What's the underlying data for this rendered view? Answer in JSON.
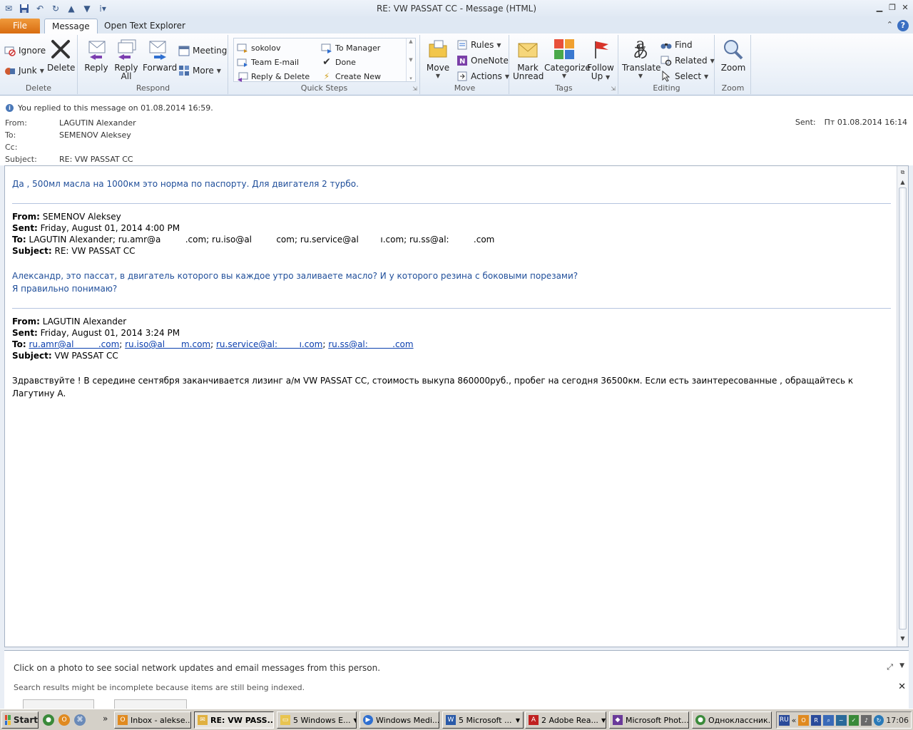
{
  "window": {
    "title": "RE: VW PASSAT CC  -  Message (HTML)"
  },
  "ribbon_tabs": {
    "file": "File",
    "message": "Message",
    "open_text_explorer": "Open Text Explorer"
  },
  "ribbon": {
    "delete_group": {
      "ignore": "Ignore",
      "junk": "Junk",
      "delete": "Delete",
      "label": "Delete"
    },
    "respond_group": {
      "reply": "Reply",
      "reply_all_1": "Reply",
      "reply_all_2": "All",
      "forward": "Forward",
      "meeting": "Meeting",
      "more": "More",
      "label": "Respond"
    },
    "quick_steps": {
      "items": [
        "sokolov",
        "Team E-mail",
        "Reply & Delete",
        "To Manager",
        "Done",
        "Create New"
      ],
      "label": "Quick Steps"
    },
    "move_group": {
      "move": "Move",
      "rules": "Rules",
      "onenote": "OneNote",
      "actions": "Actions",
      "label": "Move"
    },
    "tags_group": {
      "mark_unread_1": "Mark",
      "mark_unread_2": "Unread",
      "categorize": "Categorize",
      "follow_up_1": "Follow",
      "follow_up_2": "Up",
      "label": "Tags"
    },
    "editing_group": {
      "translate": "Translate",
      "find": "Find",
      "related": "Related",
      "select": "Select",
      "label": "Editing"
    },
    "zoom_group": {
      "zoom": "Zoom",
      "label": "Zoom"
    }
  },
  "header": {
    "info": "You replied to this message on 01.08.2014 16:59.",
    "from_label": "From:",
    "from": "LAGUTIN Alexander",
    "to_label": "To:",
    "to": "SEMENOV Aleksey",
    "cc_label": "Cc:",
    "subject_label": "Subject:",
    "subject": "RE: VW PASSAT CC",
    "sent_label": "Sent:",
    "sent": "Пт 01.08.2014 16:14"
  },
  "body": {
    "reply_text": "Да , 500мл масла на 1000км это норма по паспорту. Для двигателя 2 турбо.",
    "quote1": {
      "from_label": "From:",
      "from": " SEMENOV Aleksey",
      "sent_label": "Sent:",
      "sent": " Friday, August 01, 2014 4:00 PM",
      "to_label": "To:",
      "to": " LAGUTIN Alexander; ru.amr@a         .com; ru.iso@al         com; ru.service@al        ı.com; ru.ss@al:         .com",
      "subject_label": "Subject:",
      "subject": " RE: VW PASSAT CC",
      "line1": "Александр, это пассат, в двигатель которого вы каждое утро заливаете масло? И у которого резина с боковыми порезами?",
      "line2": "Я правильно понимаю?"
    },
    "quote2": {
      "from_label": "From:",
      "from": " LAGUTIN Alexander",
      "sent_label": "Sent:",
      "sent": " Friday, August 01, 2014 3:24 PM",
      "to_label": "To:",
      "to_links": [
        "ru.amr@al         .com",
        "ru.iso@al      m.com",
        "ru.service@al:        ı.com",
        "ru.ss@al:         .com"
      ],
      "subject_label": "Subject:",
      "subject": " VW PASSAT CC",
      "text": "Здравствуйте ! В середине сентября заканчивается лизинг а/м VW PASSAT CC, стоимость выкупа 860000руб., пробег на сегодня 36500км. Если есть заинтересованные , обращайтесь к Лагутину А."
    }
  },
  "people_pane": {
    "hint": "Click on a photo to see social network updates and email messages from this person.",
    "status": "Search results might be incomplete because items are still being indexed."
  },
  "taskbar": {
    "start": "Start",
    "buttons": [
      "Inbox - alekse...",
      "RE: VW PASS...",
      "5 Windows E...",
      "Windows Medi...",
      "5 Microsoft ...",
      "2 Adobe Rea...",
      "Microsoft Phot...",
      "Одноклассник..."
    ],
    "lang": "RU",
    "clock": "17:06"
  },
  "colors": {
    "file_tab": "#e07a20",
    "body_blue": "#1f4e9a",
    "link": "#0b3fae"
  }
}
